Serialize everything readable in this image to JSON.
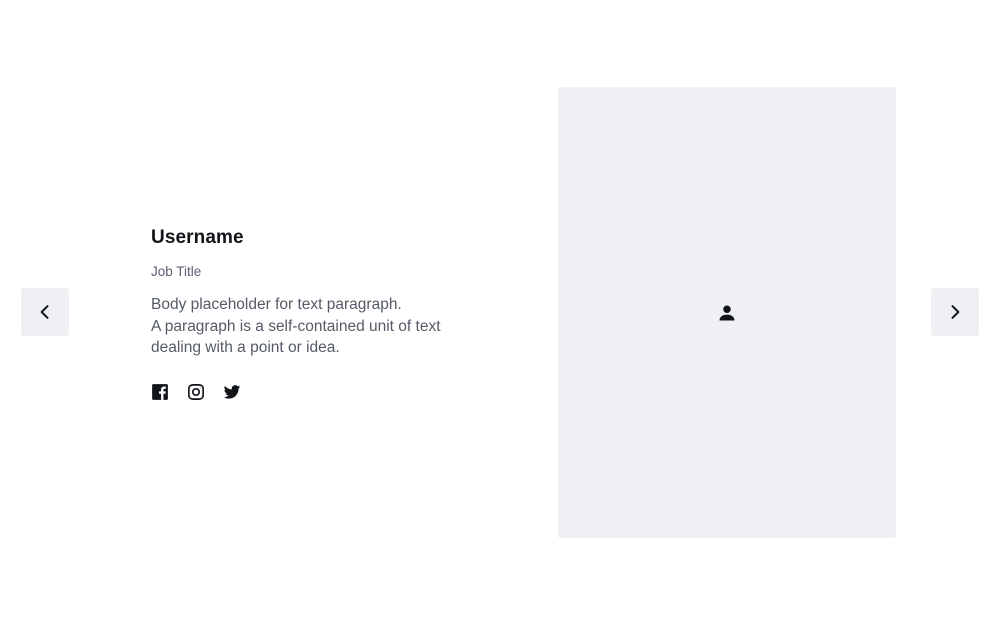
{
  "profile": {
    "username": "Username",
    "job_title": "Job Title",
    "body_lines": [
      "Body placeholder for text paragraph.",
      "A paragraph is a self-contained unit of text",
      "dealing with a point or idea."
    ]
  },
  "socials": [
    {
      "icon": "facebook-icon"
    },
    {
      "icon": "instagram-icon"
    },
    {
      "icon": "twitter-icon"
    }
  ],
  "navigation": {
    "prev_icon": "chevron-left-icon",
    "next_icon": "chevron-right-icon"
  },
  "image_placeholder": {
    "icon": "user-icon"
  },
  "colors": {
    "panel_bg": "#eff0f4",
    "nav_bg": "#eef0f4",
    "heading": "#111418",
    "body": "#555a66"
  }
}
